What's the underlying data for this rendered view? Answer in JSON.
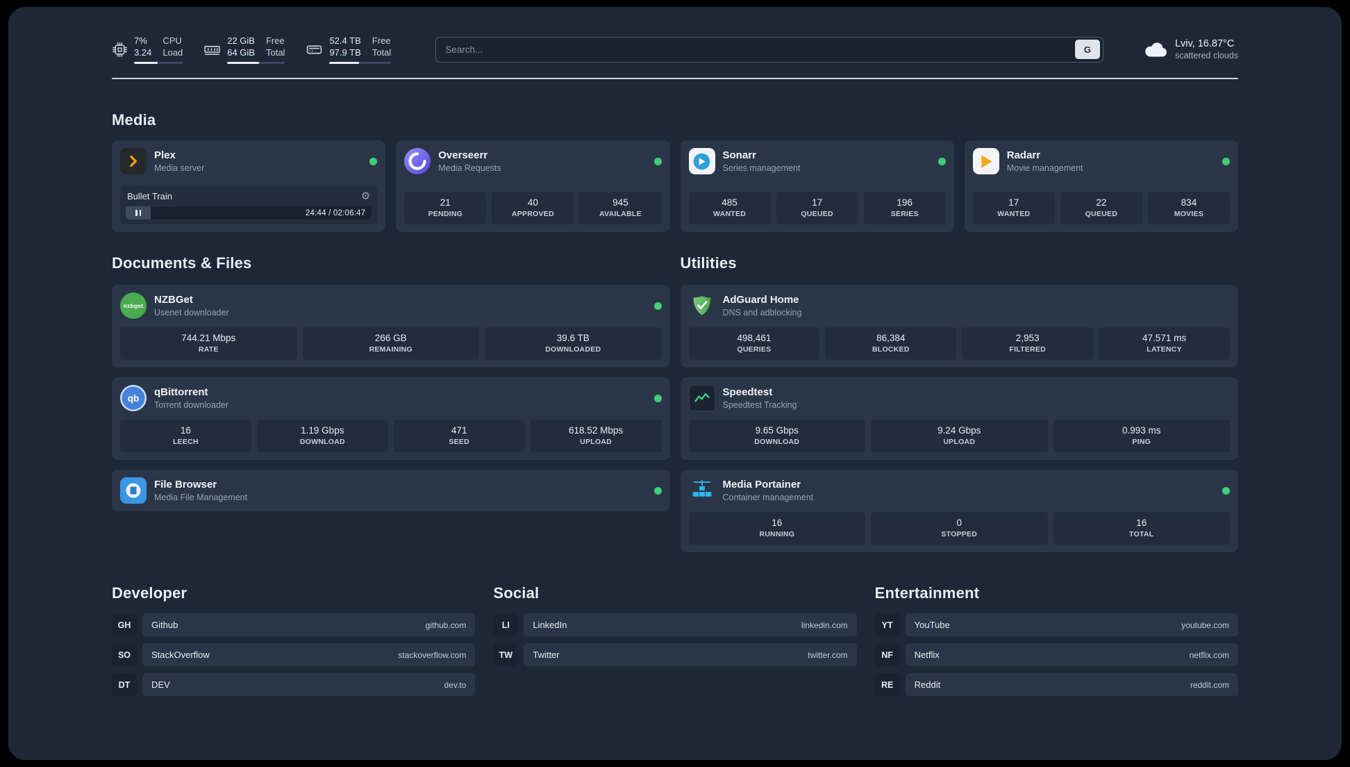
{
  "topbar": {
    "cpu": {
      "usage": "7%",
      "load": "3.24",
      "labels": [
        "CPU",
        "Load"
      ]
    },
    "memory": {
      "free": "22 GiB",
      "total": "64 GiB",
      "labels": [
        "Free",
        "Total"
      ]
    },
    "disk": {
      "free": "52.4 TB",
      "total": "97.9 TB",
      "labels": [
        "Free",
        "Total"
      ]
    },
    "search": {
      "placeholder": "Search...",
      "provider_label": "G"
    },
    "weather": {
      "location": "Lviv, 16.87°C",
      "condition": "scattered clouds"
    }
  },
  "sections": {
    "media": {
      "title": "Media"
    },
    "documents": {
      "title": "Documents & Files"
    },
    "utilities": {
      "title": "Utilities"
    },
    "developer": {
      "title": "Developer"
    },
    "social": {
      "title": "Social"
    },
    "entertainment": {
      "title": "Entertainment"
    }
  },
  "services": {
    "plex": {
      "title": "Plex",
      "subtitle": "Media server",
      "now_playing": "Bullet Train",
      "time": "24:44 / 02:06:47"
    },
    "overseerr": {
      "title": "Overseerr",
      "subtitle": "Media Requests",
      "stats": [
        {
          "value": "21",
          "label": "PENDING"
        },
        {
          "value": "40",
          "label": "APPROVED"
        },
        {
          "value": "945",
          "label": "AVAILABLE"
        }
      ]
    },
    "sonarr": {
      "title": "Sonarr",
      "subtitle": "Series management",
      "stats": [
        {
          "value": "485",
          "label": "WANTED"
        },
        {
          "value": "17",
          "label": "QUEUED"
        },
        {
          "value": "196",
          "label": "SERIES"
        }
      ]
    },
    "radarr": {
      "title": "Radarr",
      "subtitle": "Movie management",
      "stats": [
        {
          "value": "17",
          "label": "WANTED"
        },
        {
          "value": "22",
          "label": "QUEUED"
        },
        {
          "value": "834",
          "label": "MOVIES"
        }
      ]
    },
    "nzbget": {
      "title": "NZBGet",
      "subtitle": "Usenet downloader",
      "icon_text": "nzbget",
      "stats": [
        {
          "value": "744.21 Mbps",
          "label": "RATE"
        },
        {
          "value": "266 GB",
          "label": "REMAINING"
        },
        {
          "value": "39.6 TB",
          "label": "DOWNLOADED"
        }
      ]
    },
    "qbittorrent": {
      "title": "qBittorrent",
      "subtitle": "Torrent downloader",
      "icon_text": "qb",
      "stats": [
        {
          "value": "16",
          "label": "LEECH"
        },
        {
          "value": "1.19 Gbps",
          "label": "DOWNLOAD"
        },
        {
          "value": "471",
          "label": "SEED"
        },
        {
          "value": "618.52 Mbps",
          "label": "UPLOAD"
        }
      ]
    },
    "filebrowser": {
      "title": "File Browser",
      "subtitle": "Media File Management"
    },
    "adguard": {
      "title": "AdGuard Home",
      "subtitle": "DNS and adblocking",
      "stats": [
        {
          "value": "498,461",
          "label": "QUERIES"
        },
        {
          "value": "86,384",
          "label": "BLOCKED"
        },
        {
          "value": "2,953",
          "label": "FILTERED"
        },
        {
          "value": "47.571 ms",
          "label": "LATENCY"
        }
      ]
    },
    "speedtest": {
      "title": "Speedtest",
      "subtitle": "Speedtest Tracking",
      "stats": [
        {
          "value": "9.65 Gbps",
          "label": "DOWNLOAD"
        },
        {
          "value": "9.24 Gbps",
          "label": "UPLOAD"
        },
        {
          "value": "0.993 ms",
          "label": "PING"
        }
      ]
    },
    "portainer": {
      "title": "Media Portainer",
      "subtitle": "Container management",
      "stats": [
        {
          "value": "16",
          "label": "RUNNING"
        },
        {
          "value": "0",
          "label": "STOPPED"
        },
        {
          "value": "16",
          "label": "TOTAL"
        }
      ]
    }
  },
  "bookmarks": {
    "developer": [
      {
        "abbr": "GH",
        "name": "Github",
        "url": "github.com"
      },
      {
        "abbr": "SO",
        "name": "StackOverflow",
        "url": "stackoverflow.com"
      },
      {
        "abbr": "DT",
        "name": "DEV",
        "url": "dev.to"
      }
    ],
    "social": [
      {
        "abbr": "LI",
        "name": "LinkedIn",
        "url": "linkedin.com"
      },
      {
        "abbr": "TW",
        "name": "Twitter",
        "url": "twitter.com"
      }
    ],
    "entertainment": [
      {
        "abbr": "YT",
        "name": "YouTube",
        "url": "youtube.com"
      },
      {
        "abbr": "NF",
        "name": "Netflix",
        "url": "netflix.com"
      },
      {
        "abbr": "RE",
        "name": "Reddit",
        "url": "reddit.com"
      }
    ]
  },
  "colors": {
    "status_online": "#3ecf78",
    "plex_amber": "#e5a00d",
    "overseerr_purple": "#6c5ce7",
    "sonarr_blue": "#2da0d7",
    "radarr_amber": "#f7a823",
    "nzbget_green": "#4aab50",
    "qbittorrent_blue": "#4581d8",
    "adguard_green": "#5cb85f",
    "speedtest_green": "#3ad98a",
    "portainer_blue": "#2fb5f0",
    "filebrowser_blue": "#3b97e3"
  },
  "icons": {
    "cpu": "chip-icon",
    "memory": "ram-icon",
    "disk": "hard-drive-icon",
    "weather": "cloud-icon",
    "service_status": "green-dot",
    "playback": "pause-icon",
    "gear_glyph": "⚙"
  }
}
